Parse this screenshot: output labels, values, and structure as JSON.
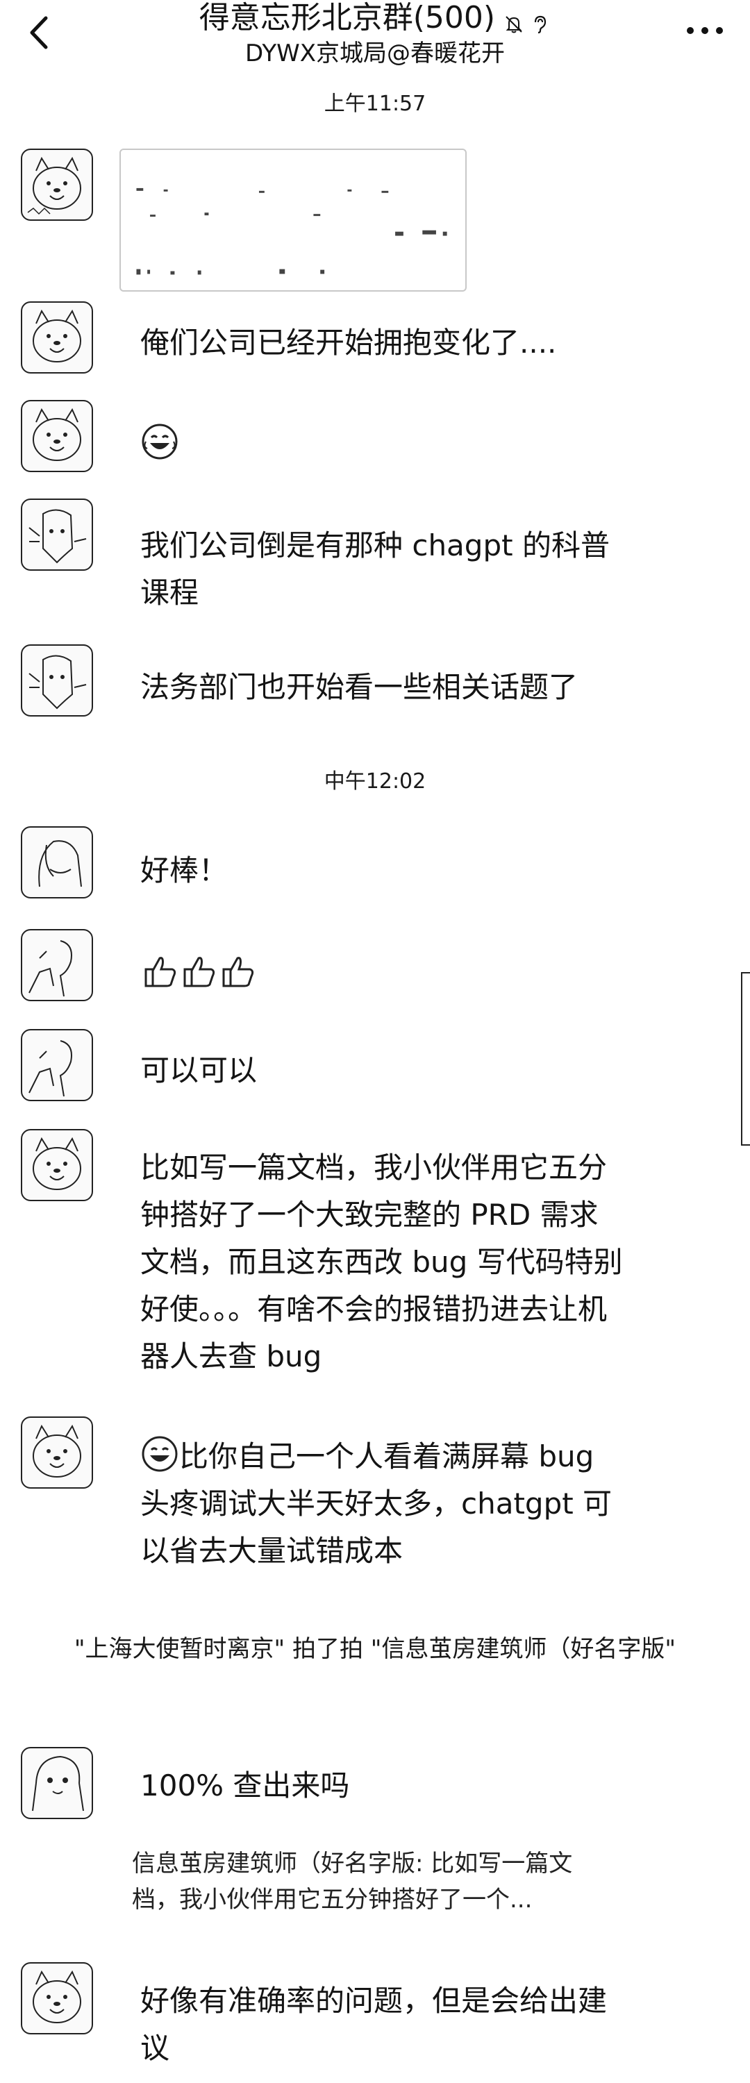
{
  "header": {
    "title": "得意忘形北京群(500)",
    "subtitle": "DYWX京城局@春暖花开",
    "icons": [
      "bell-off-icon",
      "ear-icon"
    ]
  },
  "timestamps": {
    "first": "上午11:57",
    "second": "中午12:02"
  },
  "messages": [
    {
      "text": "俺们公司已经开始拥抱变化了...."
    },
    {
      "emoji": "laughing-tears-emoji"
    },
    {
      "text": "我们公司倒是有那种 chagpt 的科普课程"
    },
    {
      "text": "法务部门也开始看一些相关话题了"
    },
    {
      "text": "好棒！"
    },
    {
      "emoji": "thumbs-up-emoji x3"
    },
    {
      "text": "可以可以"
    },
    {
      "text": "比如写一篇文档，我小伙伴用它五分钟搭好了一个大致完整的 PRD 需求文档，而且这东西改 bug 写代码特别好使。。。有啥不会的报错扔进去让机器人去查 bug"
    },
    {
      "text": "比你自己一个人看着满屏幕 bug 头疼调试大半天好太多，chatgpt 可以省去大量试错成本"
    },
    {
      "text": "100% 查出来吗"
    },
    {
      "text": "好像有准确率的问题，但是会给出建议"
    }
  ],
  "system_note": "\"上海大使暂时离京\" 拍了拍 \"信息茧房建筑师（好名字版\"",
  "quote": "信息茧房建筑师（好名字版: 比如写一篇文档，我小伙伴用它五分钟搭好了一个..."
}
